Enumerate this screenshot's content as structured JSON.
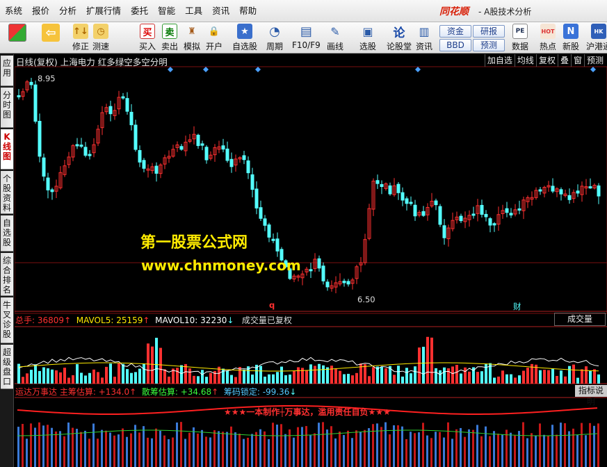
{
  "menu": [
    "系统",
    "报价",
    "分析",
    "扩展行情",
    "委托",
    "智能",
    "工具",
    "资讯",
    "帮助"
  ],
  "brand": "同花顺",
  "subtitle": "- A股技术分析",
  "toolbar": {
    "buttons": [
      {
        "label": "修正",
        "icon": "↑↓"
      },
      {
        "label": "测速",
        "icon": "◷"
      },
      {
        "label": "买入",
        "icon": "买"
      },
      {
        "label": "卖出",
        "icon": "卖"
      },
      {
        "label": "模拟",
        "icon": "♜"
      },
      {
        "label": "开户",
        "icon": "🔒"
      },
      {
        "label": "自选股",
        "icon": "★"
      },
      {
        "label": "周期",
        "icon": "◔"
      },
      {
        "label": "F10/F9",
        "icon": "▤"
      },
      {
        "label": "画线",
        "icon": "✎"
      },
      {
        "label": "选股",
        "icon": "▣"
      },
      {
        "label": "论股堂",
        "icon": "论"
      },
      {
        "label": "资讯",
        "icon": "▥"
      },
      {
        "label": "数据",
        "icon": "PE"
      },
      {
        "label": "热点",
        "icon": "HOT"
      },
      {
        "label": "新股",
        "icon": "N"
      },
      {
        "label": "沪港通",
        "icon": "HK"
      }
    ],
    "small": [
      "资金",
      "BBD",
      "研报",
      "预测"
    ]
  },
  "lefttabs": [
    "应用",
    "分时图",
    "K线图",
    "个股资料",
    "自选股",
    "综合排名",
    "牛叉诊股",
    "超级盘口"
  ],
  "chart": {
    "title": "日线(复权) 上海电力 红多绿空多空分明",
    "buttons": [
      "加自选",
      "均线",
      "复权",
      "叠",
      "窗",
      "预测"
    ],
    "high_label": "8.95",
    "low_label": "6.50",
    "marker_q": "q",
    "marker_cai": "财"
  },
  "volume": {
    "total_label": "总手:",
    "total": "36809",
    "ma5_label": "MAVOL5:",
    "ma5": "25159",
    "ma10_label": "MAVOL10:",
    "ma10": "32230",
    "note": "成交量已复权",
    "button": "成交量"
  },
  "indicator": {
    "name": "运达万事达",
    "main_label": "主筹估算:",
    "main": "+134.0",
    "scatter_label": "散筹估算:",
    "scatter": "+34.68",
    "lock_label": "筹码锁定:",
    "lock": "-99.36",
    "banner": "★★★一本制作┼万事达，滥用责任自负★★★",
    "button": "指标说明"
  },
  "watermark": {
    "line1": "第一股票公式网",
    "line2": "www.chnmoney.com"
  },
  "colors": {
    "up": "#ff3030",
    "down": "#54ffff",
    "accent": "#ffeb00",
    "ma5": "#ffffff",
    "ma10": "#ffeb00"
  }
}
